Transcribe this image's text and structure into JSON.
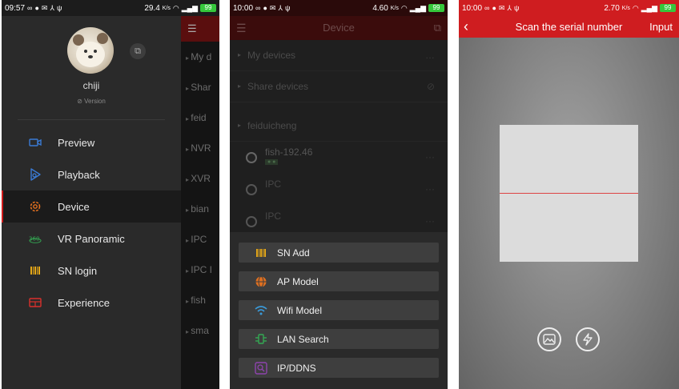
{
  "screen1": {
    "status": {
      "time": "09:57",
      "speed": "29.4",
      "speed_unit": "K/s",
      "battery": "99"
    },
    "user": {
      "name": "chiji",
      "version_label": "Version"
    },
    "menu": [
      {
        "label": "Preview",
        "icon": "camera-icon",
        "color": "#3a7bd5"
      },
      {
        "label": "Playback",
        "icon": "playback-icon",
        "color": "#3a7bd5"
      },
      {
        "label": "Device",
        "icon": "gear-icon",
        "color": "#e07020"
      },
      {
        "label": "VR Panoramic",
        "icon": "vr-360-icon",
        "color": "#34a853"
      },
      {
        "label": "SN login",
        "icon": "barcode-icon",
        "color": "#e6a817"
      },
      {
        "label": "Experience",
        "icon": "experience-icon",
        "color": "#d9302c"
      }
    ],
    "behind_rows": [
      "My d",
      "Shar",
      "feid",
      "NVR",
      "XVR",
      "bian",
      "IPC",
      "IPC I",
      "fish",
      "sma"
    ]
  },
  "screen2": {
    "status": {
      "time": "10:00",
      "speed": "4.60",
      "speed_unit": "K/s",
      "battery": "99"
    },
    "title": "Device",
    "sections": [
      "My devices",
      "Share devices"
    ],
    "group": "feiduicheng",
    "devices": [
      {
        "name": "fish-192.46"
      },
      {
        "name": "IPC"
      },
      {
        "name": "IPC"
      }
    ],
    "options": [
      {
        "label": "SN Add",
        "icon": "barcode-icon",
        "color": "#e6a817"
      },
      {
        "label": "AP Model",
        "icon": "globe-icon",
        "color": "#e07020"
      },
      {
        "label": "Wifi Model",
        "icon": "wifi-icon",
        "color": "#3a9ad9"
      },
      {
        "label": "LAN Search",
        "icon": "lan-icon",
        "color": "#34a853"
      },
      {
        "label": "IP/DDNS",
        "icon": "ip-icon",
        "color": "#8e44ad"
      }
    ]
  },
  "screen3": {
    "status": {
      "time": "10:00",
      "speed": "2.70",
      "speed_unit": "K/s",
      "battery": "99"
    },
    "title": "Scan the serial number",
    "input_label": "Input"
  }
}
